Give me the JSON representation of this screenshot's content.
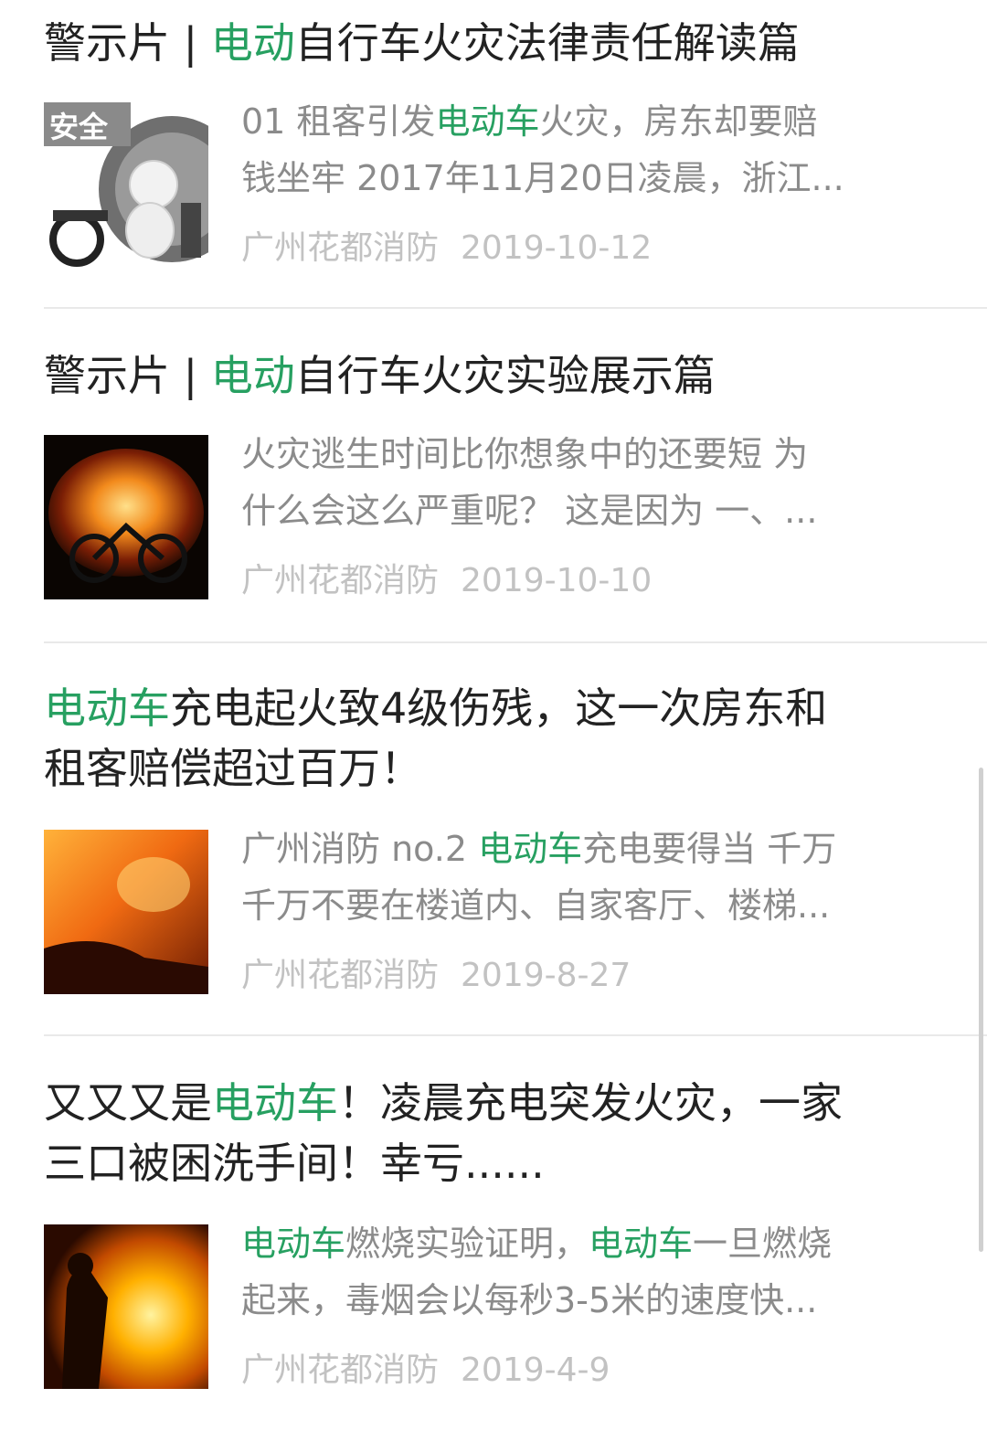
{
  "colors": {
    "highlight": "#27a061",
    "title": "#222222",
    "summary": "#8b8b8b",
    "meta": "#c2c2c2"
  },
  "articles": [
    {
      "title": {
        "pre": "警示片 | ",
        "hl": "电动",
        "post": "自行车火灾法律责任解读篇"
      },
      "summary_line1": {
        "pre": "01 租客引发",
        "hl": "电动车",
        "post": "火灾，房东却要赔"
      },
      "summary_line2": "钱坐牢 2017年11月20日凌晨，浙江...",
      "source": "广州花都消防",
      "date": "2019-10-12",
      "thumb_text": "安全",
      "thumb_icon": "safety-cartoon-icon"
    },
    {
      "title": {
        "pre": "警示片 | ",
        "hl": "电动",
        "post": "自行车火灾实验展示篇"
      },
      "summary_line1": "火灾逃生时间比你想象中的还要短 为",
      "summary_line2": "什么会这么严重呢？ 这是因为 一、...",
      "source": "广州花都消防",
      "date": "2019-10-10",
      "thumb_icon": "burning-bike-image"
    },
    {
      "title": {
        "hl": "电动车",
        "post": "充电起火致4级伤残，这一次房东和",
        "line2": "租客赔偿超过百万！"
      },
      "summary_line1": {
        "pre": "广州消防 no.2 ",
        "hl": "电动车",
        "post": "充电要得当 千万"
      },
      "summary_line2": "千万不要在楼道内、自家客厅、楼梯...",
      "source": "广州花都消防",
      "date": "2019-8-27",
      "thumb_icon": "fire-image"
    },
    {
      "title": {
        "pre": "又又又是",
        "hl": "电动车",
        "post": "！凌晨充电突发火灾，一家",
        "line2": "三口被困洗手间！幸亏......"
      },
      "summary_line1": {
        "hl": "电动车",
        "mid": "燃烧实验证明，",
        "hl2": "电动车",
        "post": "一旦燃烧"
      },
      "summary_line2": "起来，毒烟会以每秒3-5米的速度快...",
      "source": "广州花都消防",
      "date": "2019-4-9",
      "thumb_icon": "fire-rescue-image"
    }
  ]
}
